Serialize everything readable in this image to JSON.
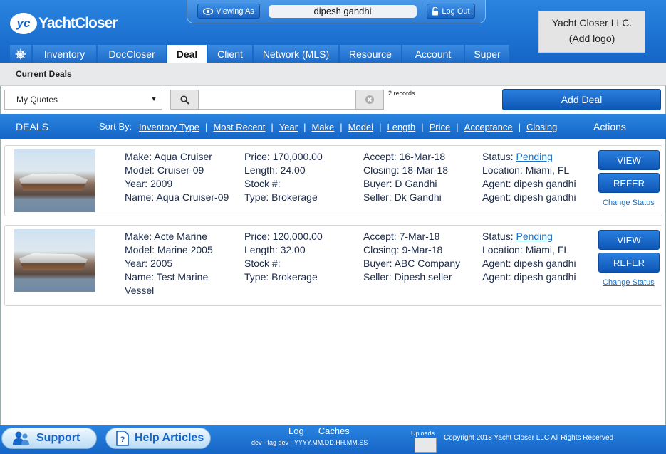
{
  "header": {
    "logo_mark": "yc",
    "logo_text": "YachtCloser",
    "viewing_as": "Viewing As",
    "user_name": "dipesh gandhi",
    "log_out": "Log Out",
    "company_name": "Yacht Closer LLC.",
    "company_logo_hint": "(Add logo)",
    "tabs": [
      {
        "label": "Inventory"
      },
      {
        "label": "DocCloser"
      },
      {
        "label": "Deal"
      },
      {
        "label": "Client"
      },
      {
        "label": "Network (MLS)"
      },
      {
        "label": "Resource"
      },
      {
        "label": "Account"
      },
      {
        "label": "Super"
      }
    ],
    "active_tab": "Deal"
  },
  "subnav": {
    "label": "Current Deals"
  },
  "toolbar": {
    "filter_value": "My Quotes",
    "search_value": "",
    "records": "2 records",
    "add_deal": "Add Deal"
  },
  "sortbar": {
    "deals_label": "DEALS",
    "sort_by": "Sort By:",
    "links": [
      "Inventory Type",
      "Most Recent",
      "Year",
      "Make",
      "Model",
      "Length",
      "Price",
      "Acceptance",
      "Closing"
    ],
    "actions": "Actions"
  },
  "deals": [
    {
      "make": "Make: Aqua Cruiser",
      "model": "Model: Cruiser-09",
      "year": "Year: 2009",
      "name": "Name: Aqua Cruiser-09",
      "name2": "",
      "price": "Price: 170,000.00",
      "length": "Length: 24.00",
      "stock": "Stock #:",
      "type": "Type: Brokerage",
      "accept": "Accept: 16-Mar-18",
      "closing": "Closing: 18-Mar-18",
      "buyer": "Buyer: D Gandhi",
      "seller": "Seller: Dk Gandhi",
      "status_label": "Status:",
      "status": "Pending",
      "location": "Location: Miami, FL",
      "agent1": "Agent: dipesh gandhi",
      "agent2": "Agent: dipesh gandhi",
      "view": "VIEW",
      "refer": "REFER",
      "change_status": "Change Status"
    },
    {
      "make": "Make: Acte Marine",
      "model": "Model: Marine 2005",
      "year": "Year: 2005",
      "name": "Name: Test Marine",
      "name2": "Vessel",
      "price": "Price: 120,000.00",
      "length": "Length: 32.00",
      "stock": "Stock #:",
      "type": "Type: Brokerage",
      "accept": "Accept: 7-Mar-18",
      "closing": "Closing: 9-Mar-18",
      "buyer": "Buyer: ABC Company",
      "seller": "Seller: Dipesh seller",
      "status_label": "Status:",
      "status": "Pending",
      "location": "Location: Miami, FL",
      "agent1": "Agent: dipesh gandhi",
      "agent2": "Agent: dipesh gandhi",
      "view": "VIEW",
      "refer": "REFER",
      "change_status": "Change Status"
    }
  ],
  "footer": {
    "support": "Support",
    "help": "Help Articles",
    "log": "Log",
    "caches": "Caches",
    "tag": "dev - tag dev - YYYY.MM.DD.HH.MM.SS",
    "uploads": "Uploads",
    "copyright": "Copyright 2018 Yacht Closer LLC All Rights Reserved"
  }
}
